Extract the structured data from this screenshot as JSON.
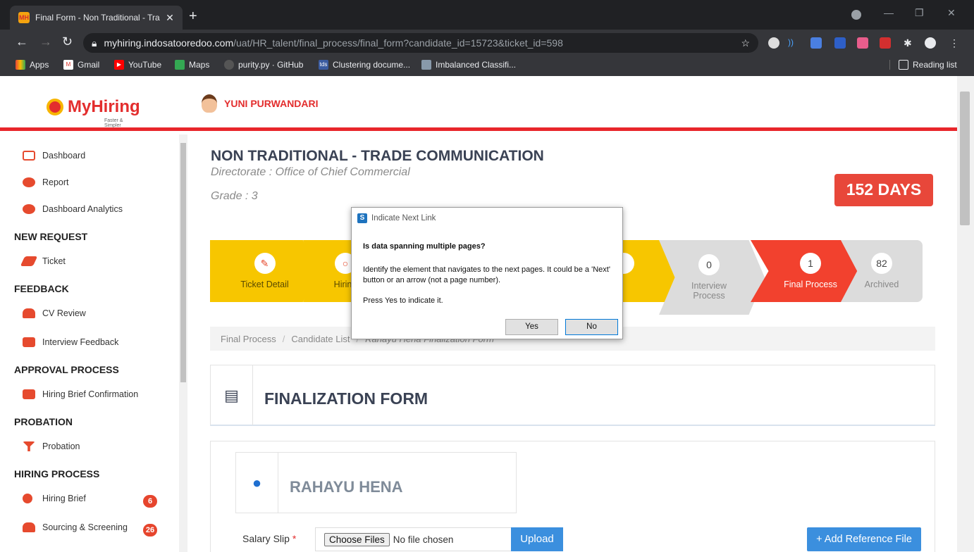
{
  "browser": {
    "tab_title": "Final Form - Non Traditional - Tra",
    "url_host": "myhiring.indosatooredoo.com",
    "url_path": "/uat/HR_talent/final_process/final_form?candidate_id=15723&ticket_id=598",
    "bookmarks": [
      {
        "label": "Apps"
      },
      {
        "label": "Gmail"
      },
      {
        "label": "YouTube"
      },
      {
        "label": "Maps"
      },
      {
        "label": "purity.py · GitHub"
      },
      {
        "label": "Clustering docume..."
      },
      {
        "label": "Imbalanced Classifi..."
      }
    ],
    "reading_list": "Reading list"
  },
  "header": {
    "logo_text": "MyHiring",
    "logo_tagline": "Faster & Simpler",
    "user_name": "YUNI PURWANDARI"
  },
  "sidebar": {
    "items": [
      {
        "label": "Dashboard"
      },
      {
        "label": "Report"
      },
      {
        "label": "Dashboard Analytics"
      },
      {
        "label": "Ticket"
      },
      {
        "label": "CV Review"
      },
      {
        "label": "Interview Feedback"
      },
      {
        "label": "Hiring Brief Confirmation"
      },
      {
        "label": "Probation"
      },
      {
        "label": "Hiring Brief",
        "badge": "6"
      },
      {
        "label": "Sourcing & Screening",
        "badge": "26"
      }
    ],
    "headings": [
      "NEW REQUEST",
      "FEEDBACK",
      "APPROVAL PROCESS",
      "PROBATION",
      "HIRING PROCESS"
    ]
  },
  "job": {
    "title": "NON TRADITIONAL - TRADE COMMUNICATION",
    "directorate": "Directorate : Office of Chief Commercial",
    "grade": "Grade : 3",
    "days": "152 DAYS"
  },
  "steps": [
    {
      "label": "Ticket Detail",
      "count": ""
    },
    {
      "label": "Hiring",
      "count": ""
    },
    {
      "label": "eview",
      "count": ""
    },
    {
      "label": "Interview Process",
      "count": "0"
    },
    {
      "label": "Final Process",
      "count": "1"
    },
    {
      "label": "Archived",
      "count": "82"
    }
  ],
  "breadcrumb": [
    "Final Process",
    "Candidate List",
    "Rahayu Hena Finalization Form"
  ],
  "form": {
    "title": "FINALIZATION FORM",
    "candidate_name": "RAHAYU HENA",
    "salary_label": "Salary Slip",
    "required_mark": "*",
    "choose_files": "Choose Files",
    "no_file": "No file chosen",
    "upload": "Upload",
    "add_reference": "+ Add Reference File"
  },
  "dialog": {
    "title": "Indicate Next Link",
    "question": "Is data spanning multiple pages?",
    "body": "Identify the element that navigates to the next pages. It could be a 'Next' button or an arrow (not a page number).",
    "instruction": "Press Yes to indicate it.",
    "yes": "Yes",
    "no": "No"
  }
}
